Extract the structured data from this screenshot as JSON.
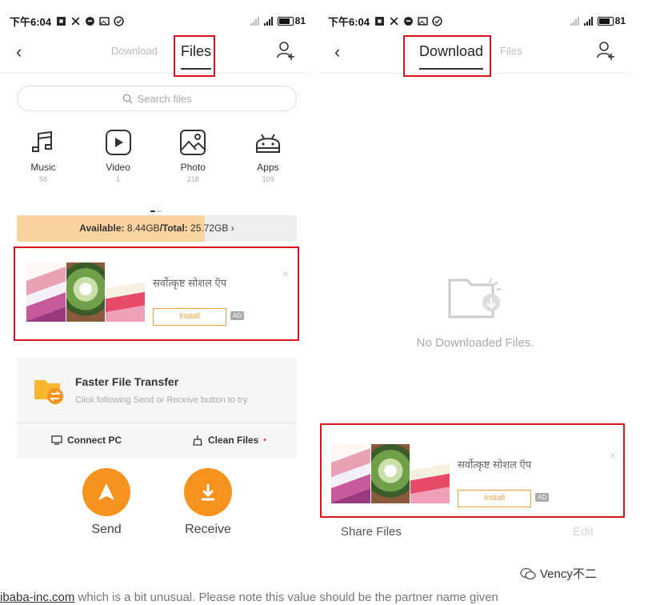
{
  "status": {
    "time": "下午6:04",
    "battery": "81",
    "status_icons": [
      "notification-icon",
      "scissors-icon",
      "message-icon",
      "image-icon",
      "check-circle-icon"
    ]
  },
  "left": {
    "tabs": {
      "download": "Download",
      "files": "Files"
    },
    "search_placeholder": "Search files",
    "categories": [
      {
        "label": "Music",
        "count": "58",
        "icon": "music-icon"
      },
      {
        "label": "Video",
        "count": "1",
        "icon": "video-icon"
      },
      {
        "label": "Photo",
        "count": "218",
        "icon": "photo-icon"
      },
      {
        "label": "Apps",
        "count": "109",
        "icon": "android-icon"
      }
    ],
    "storage": {
      "available_label": "Available:",
      "available": "8.44GB",
      "total_label": "/Total:",
      "total": "25.72GB",
      "used_fraction": 0.672
    },
    "ad": {
      "title": "सर्वोत्कृष्ट सोशल ऍप",
      "install": "Install",
      "badge": "AD",
      "close": "×"
    },
    "transfer": {
      "title": "Faster File Transfer",
      "subtitle": "Click following Send or Receive button to try.",
      "connect_pc": "Connect PC",
      "clean_files": "Clean Files",
      "clean_dot": "•"
    },
    "send": "Send",
    "receive": "Receive"
  },
  "right": {
    "tabs": {
      "download": "Download",
      "files": "Files"
    },
    "empty_text": "No Downloaded Files.",
    "ad": {
      "title": "सर्वोत्कृष्ट सोशल ऍप",
      "install": "Install",
      "badge": "AD",
      "close": "×"
    },
    "share_files": "Share Files",
    "edit": "Edit"
  },
  "watermark": "Vency不二",
  "caption": {
    "link": "ibaba-inc.com",
    "text": " which is a bit unusual. Please note this value should be the partner name given"
  },
  "colors": {
    "accent": "#f6921e",
    "highlight_box": "#d9151b",
    "storage_fill": "#f9d3a0"
  }
}
